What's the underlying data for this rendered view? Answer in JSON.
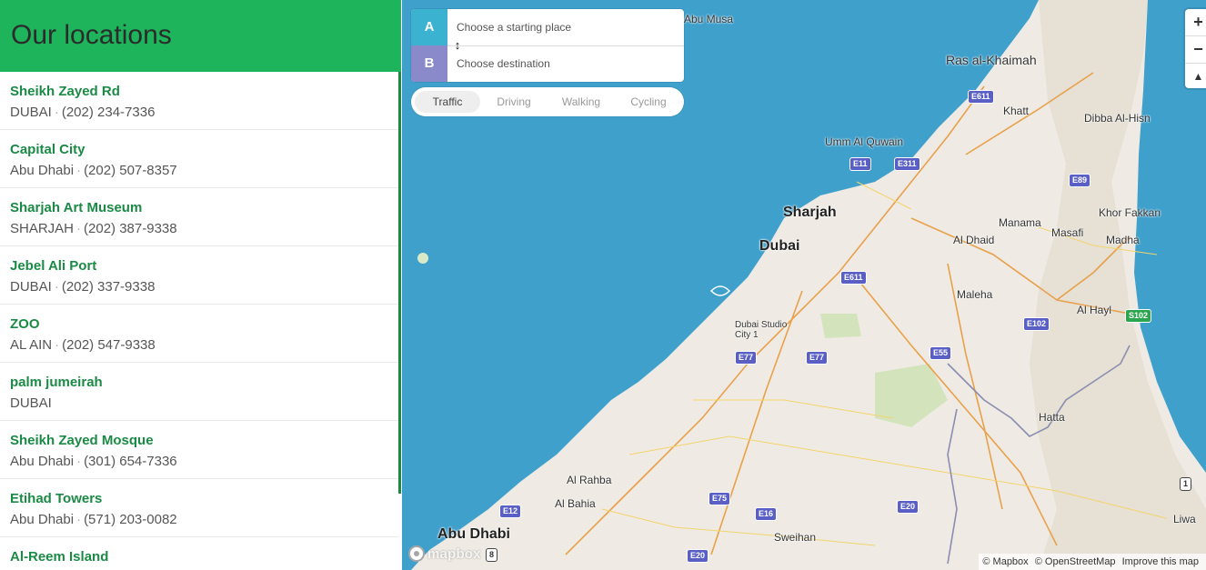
{
  "sidebar": {
    "title": "Our locations",
    "items": [
      {
        "name": "Sheikh Zayed Rd",
        "city": "DUBAI",
        "phone": "(202) 234-7336"
      },
      {
        "name": "Capital City",
        "city": "Abu Dhabi",
        "phone": "(202) 507-8357"
      },
      {
        "name": "Sharjah Art Museum",
        "city": "SHARJAH",
        "phone": "(202) 387-9338"
      },
      {
        "name": "Jebel Ali Port",
        "city": "DUBAI",
        "phone": "(202) 337-9338"
      },
      {
        "name": "ZOO",
        "city": "AL AIN",
        "phone": "(202) 547-9338"
      },
      {
        "name": "palm jumeirah",
        "city": "DUBAI",
        "phone": ""
      },
      {
        "name": "Sheikh Zayed Mosque",
        "city": "Abu Dhabi",
        "phone": "(301) 654-7336"
      },
      {
        "name": "Etihad Towers",
        "city": "Abu Dhabi",
        "phone": "(571) 203-0082"
      },
      {
        "name": "Al-Reem Island",
        "city": "",
        "phone": ""
      }
    ],
    "separator": "·"
  },
  "directions": {
    "origin_label": "A",
    "destination_label": "B",
    "origin_placeholder": "Choose a starting place",
    "destination_placeholder": "Choose destination",
    "reverse_symbol": "↕",
    "profiles": [
      "Traffic",
      "Driving",
      "Walking",
      "Cycling"
    ],
    "active_profile": "Traffic"
  },
  "map_controls": {
    "zoom_in": "+",
    "zoom_out": "−",
    "compass": "▲"
  },
  "attribution": {
    "mapbox": "© Mapbox",
    "osm": "© OpenStreetMap",
    "improve": "Improve this map",
    "logo_text": "mapbox"
  },
  "map_labels": {
    "cities": [
      "Abu Musa",
      "Ras al-Khaimah",
      "Khatt",
      "Dibba Al-Hisn",
      "Umm Al Quwain",
      "Sharjah",
      "Dubai",
      "Manama",
      "Masafi",
      "Khor Fakkan",
      "Al Dhaid",
      "Madha",
      "Maleha",
      "Al Hayl",
      "Dubai Studio City 1",
      "Hatta",
      "Al Rahba",
      "Al Bahia",
      "Abu Dhabi",
      "Sweihan",
      "Liwa"
    ],
    "shields": [
      "E611",
      "E11",
      "E311",
      "E89",
      "E611",
      "E102",
      "S102",
      "E77",
      "E77",
      "E55",
      "E12",
      "E75",
      "E16",
      "E20",
      "E20",
      "8",
      "1"
    ]
  },
  "colors": {
    "accent_green": "#1db45c",
    "title_green": "#1a8a45",
    "water": "#3fa0cc",
    "land": "#efebe4",
    "origin_marker": "#3bb2d0",
    "destination_marker": "#8a8acb",
    "highway_shield": "#5a5fc6"
  }
}
